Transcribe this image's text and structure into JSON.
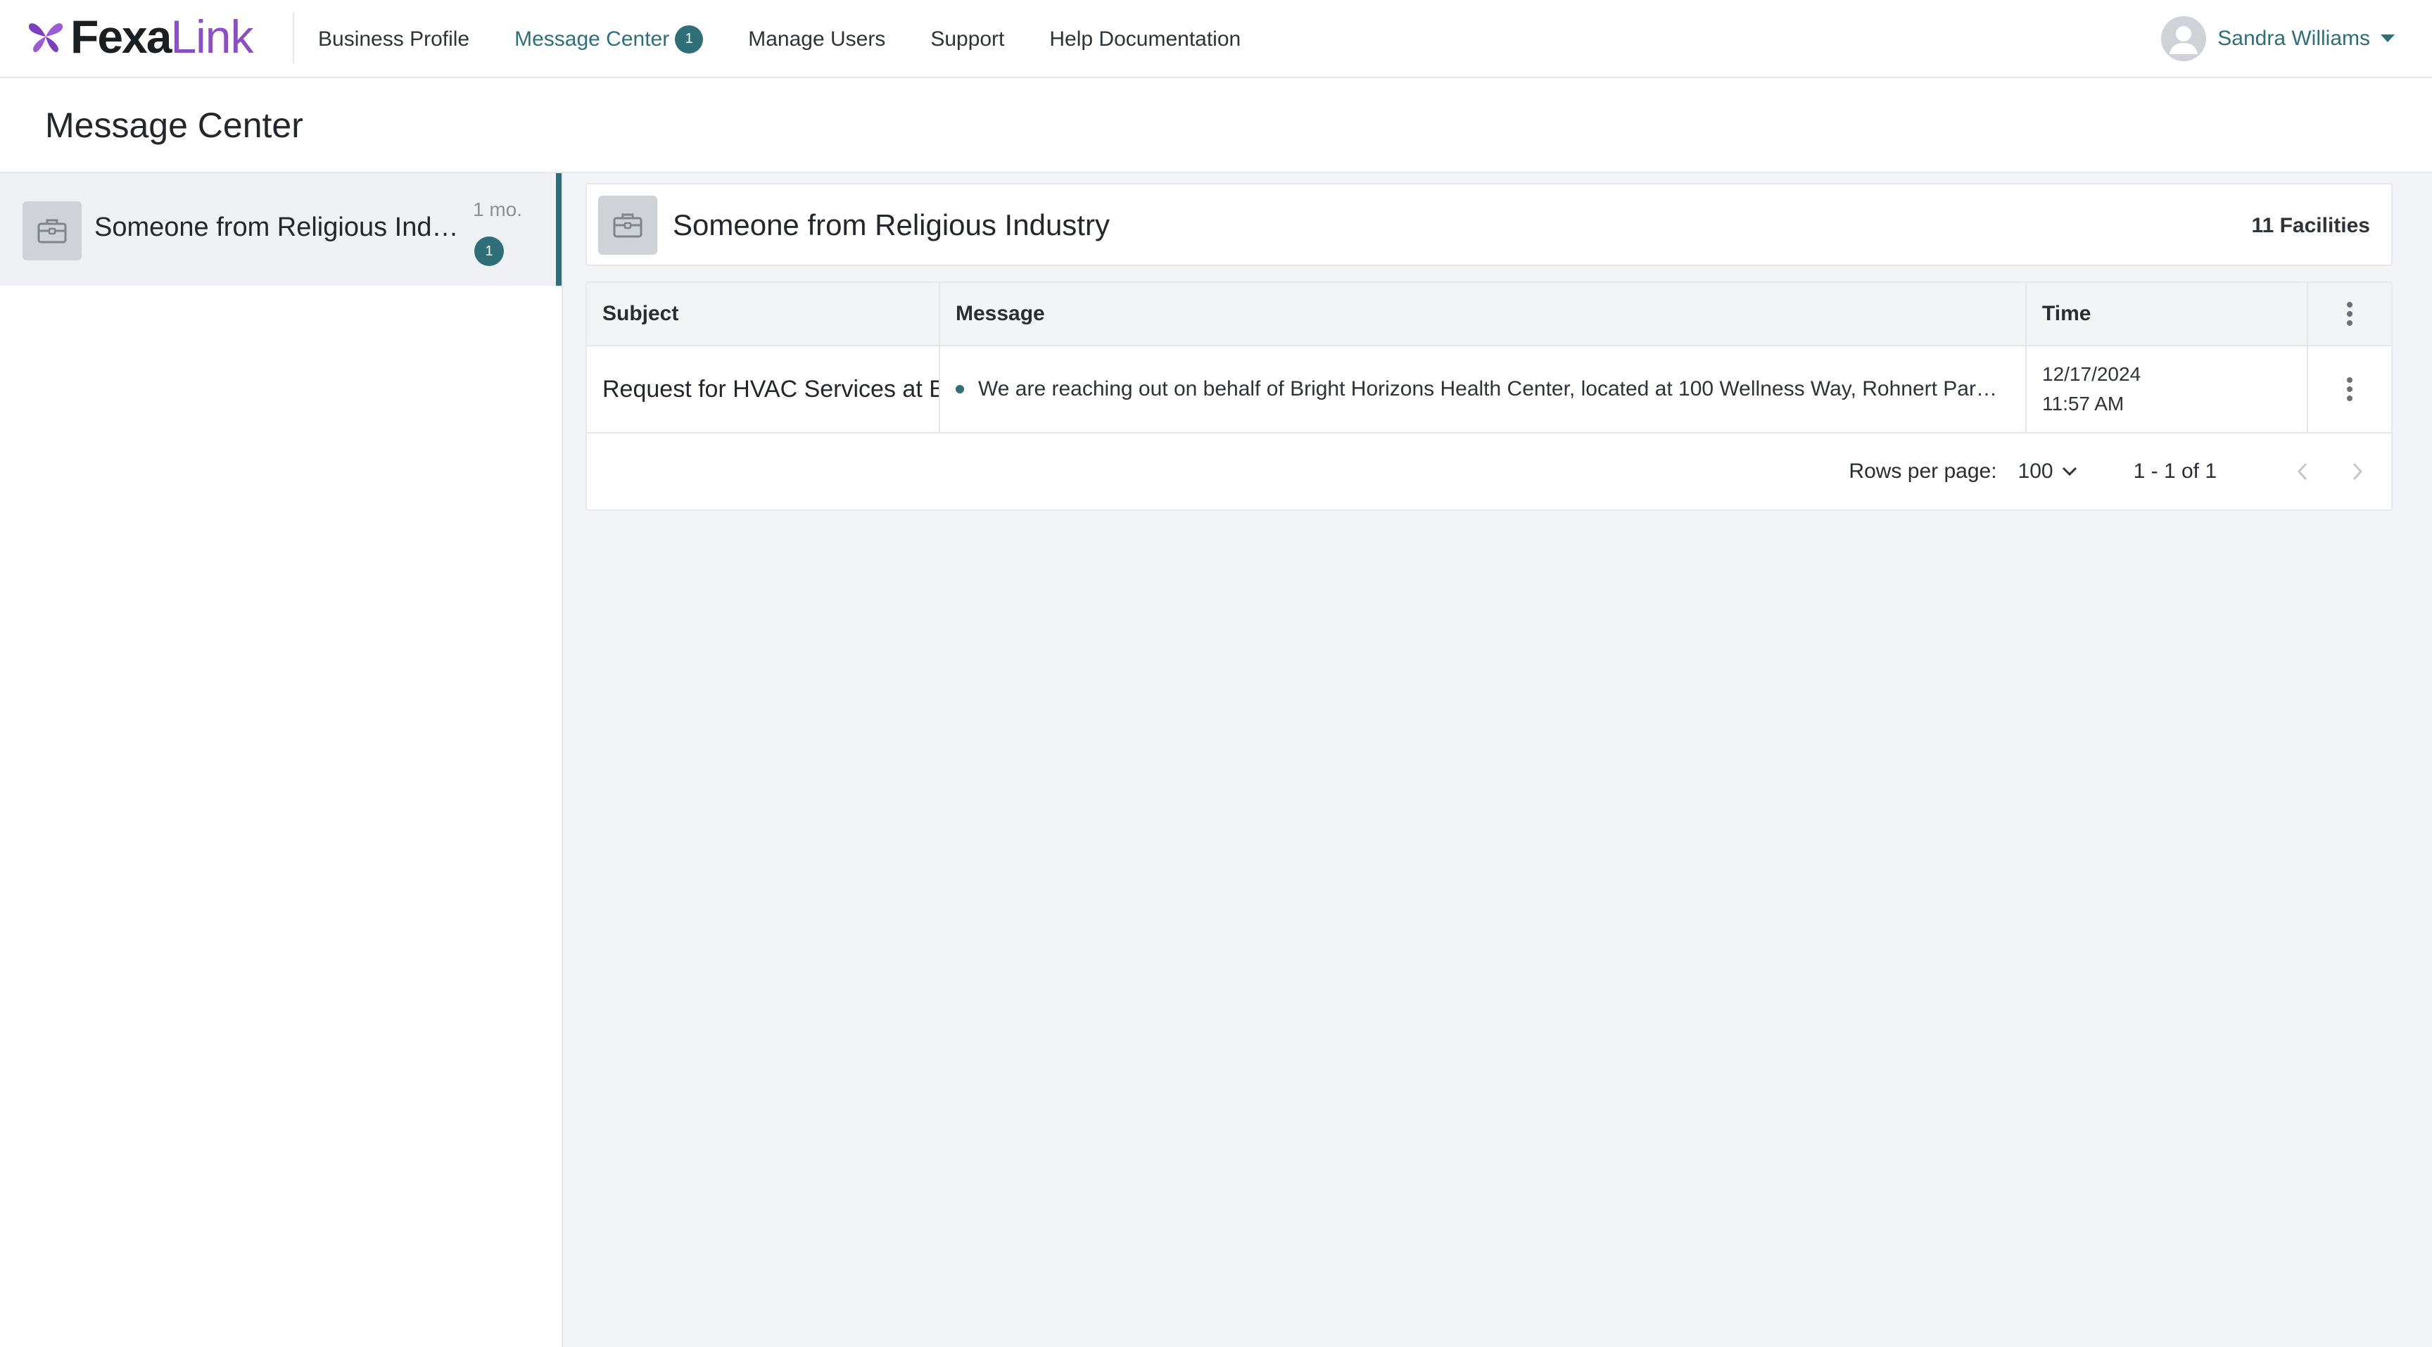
{
  "brand": {
    "name_a": "Fexa",
    "name_b": "Link",
    "accent": "#2e6f78",
    "logo_color": "#8a4fc4"
  },
  "nav": {
    "items": [
      {
        "label": "Business Profile"
      },
      {
        "label": "Message Center",
        "badge": "1",
        "active": true
      },
      {
        "label": "Manage Users"
      },
      {
        "label": "Support"
      },
      {
        "label": "Help Documentation"
      }
    ]
  },
  "user": {
    "name": "Sandra Williams"
  },
  "page": {
    "title": "Message Center"
  },
  "sidebar": {
    "threads": [
      {
        "name": "Someone from Religious Industry",
        "time": "1 mo.",
        "unread": "1",
        "icon": "briefcase-icon"
      }
    ]
  },
  "conversation": {
    "title": "Someone from Religious Industry",
    "facilities": "11 Facilities",
    "icon": "briefcase-icon"
  },
  "table": {
    "columns": [
      "Subject",
      "Message",
      "Time"
    ],
    "rows": [
      {
        "subject": "Request for HVAC Services at Bright Horizons Health Center",
        "message": "We are reaching out on behalf of Bright Horizons Health Center, located at 100 Wellness Way, Rohnert Park, Ca...",
        "date": "12/17/2024",
        "time": "11:57 AM",
        "unread": true
      }
    ]
  },
  "pagination": {
    "rows_label": "Rows per page:",
    "rows_value": "100",
    "range": "1 - 1 of 1"
  }
}
